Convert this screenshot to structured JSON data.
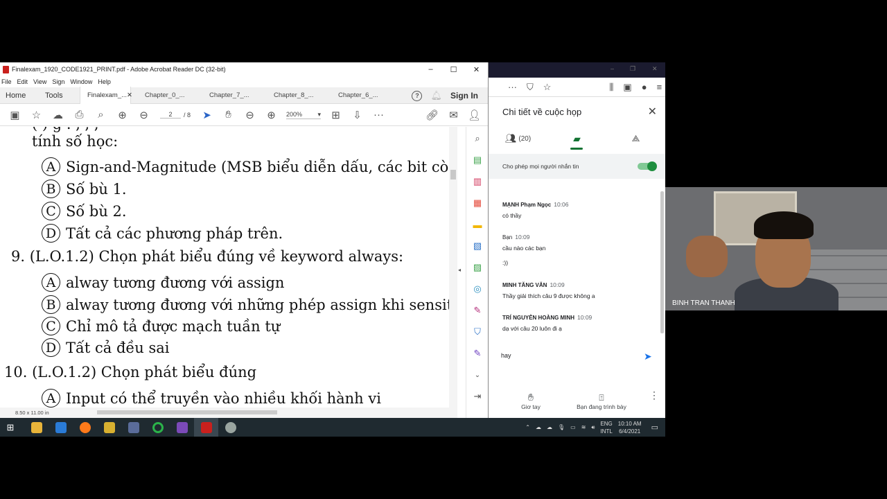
{
  "acrobat": {
    "title": "Finalexam_1920_CODE1921_PRINT.pdf - Adobe Acrobat Reader DC (32-bit)",
    "menu": [
      "File",
      "Edit",
      "View",
      "Sign",
      "Window",
      "Help"
    ],
    "tabs": {
      "home": "Home",
      "tools": "Tools",
      "active_doc": "Finalexam_...",
      "docs": [
        "Chapter_0_...",
        "Chapter_7_...",
        "Chapter_8_...",
        "Chapter_6_..."
      ],
      "sign_in": "Sign In"
    },
    "toolbar": {
      "page_current": "2",
      "page_total": "/ 8",
      "zoom": "200%"
    },
    "page_size_label": "8.50 x 11.00 in",
    "content": {
      "frag_top": "tính số học:",
      "q8_options": [
        {
          "letter": "A",
          "text": "Sign-and-Magnitude (MSB biểu diễn dấu, các bit còn"
        },
        {
          "letter": "B",
          "text": "Số bù 1."
        },
        {
          "letter": "C",
          "text": "Số bù 2."
        },
        {
          "letter": "D",
          "text": "Tất cả các phương pháp trên."
        }
      ],
      "q9": "9.  (L.O.1.2) Chọn phát biểu đúng về keyword always:",
      "q9_options": [
        {
          "letter": "A",
          "text": "alway tương đương với assign"
        },
        {
          "letter": "B",
          "text": "alway tương đương với những phép assign khi sensitiv"
        },
        {
          "letter": "C",
          "text": "Chỉ mô tả được mạch tuần tự"
        },
        {
          "letter": "D",
          "text": "Tất cả đều sai"
        }
      ],
      "q10": "10.  (L.O.1.2) Chọn phát biểu đúng",
      "q10_options": [
        {
          "letter": "A",
          "text": "Input có thể truyền vào nhiều khối hành vi"
        }
      ]
    }
  },
  "meet": {
    "title": "Chi tiết về cuộc họp",
    "people_count": "(20)",
    "allow_label": "Cho phép mọi người nhắn tin",
    "messages": [
      {
        "who": "MẠNH Phạm Ngọc",
        "time": "10:06",
        "text": "có thầy"
      },
      {
        "who": "Bạn",
        "time": "10:09",
        "text": "cầu nào các bạn",
        "text2": ":))"
      },
      {
        "who": "MINH TĂNG VĂN",
        "time": "10:09",
        "text": "Thầy giải thích câu 9 được không a"
      },
      {
        "who": "TRÍ NGUYỄN HOÀNG MINH",
        "time": "10:09",
        "text": "dạ với câu 20 luôn đi ạ"
      }
    ],
    "input_value": "hay",
    "raise_hand": "Giơ tay",
    "presenting": "Bạn đang trình bày"
  },
  "taskbar": {
    "lang1": "ENG",
    "lang2": "INTL",
    "time": "10:10 AM",
    "date": "6/4/2021"
  },
  "webcam": {
    "name": "BINH TRAN THANH"
  }
}
